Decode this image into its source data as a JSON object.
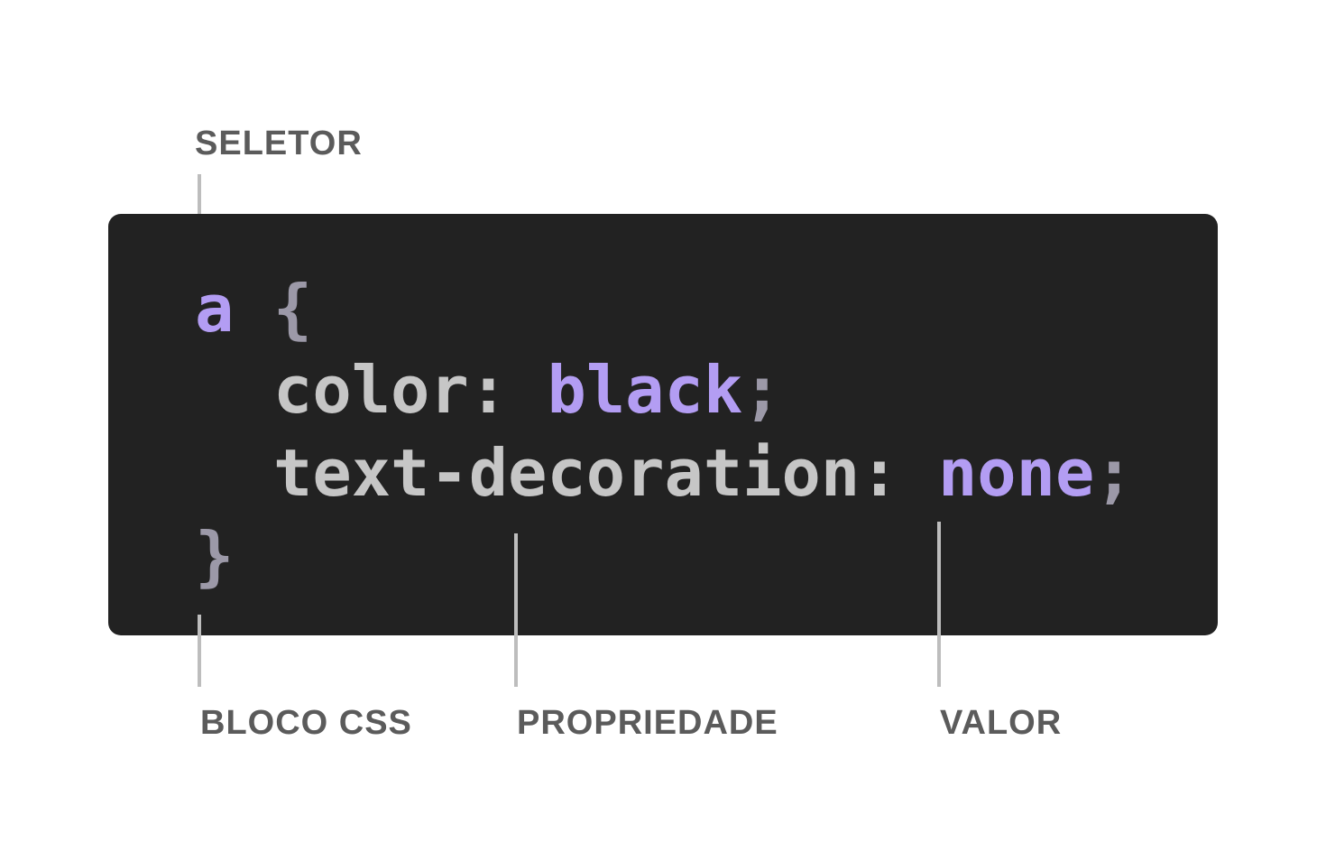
{
  "labels": {
    "selector": "SELETOR",
    "block": "BLOCO CSS",
    "property": "PROPRIEDADE",
    "value": "VALOR"
  },
  "code": {
    "selector": "a",
    "open_brace": "{",
    "close_brace": "}",
    "declarations": [
      {
        "property": "color",
        "colon": ":",
        "value": "black",
        "semicolon": ";"
      },
      {
        "property": "text-decoration",
        "colon": ":",
        "value": "none",
        "semicolon": ";"
      }
    ]
  },
  "colors": {
    "background": "#ffffff",
    "code_background": "#222222",
    "selector_value": "#b39df3",
    "punctuation": "#9c99a8",
    "property": "#c6c6c6",
    "label_text": "#5b5b5b",
    "leader_line": "#bdbdbd"
  }
}
